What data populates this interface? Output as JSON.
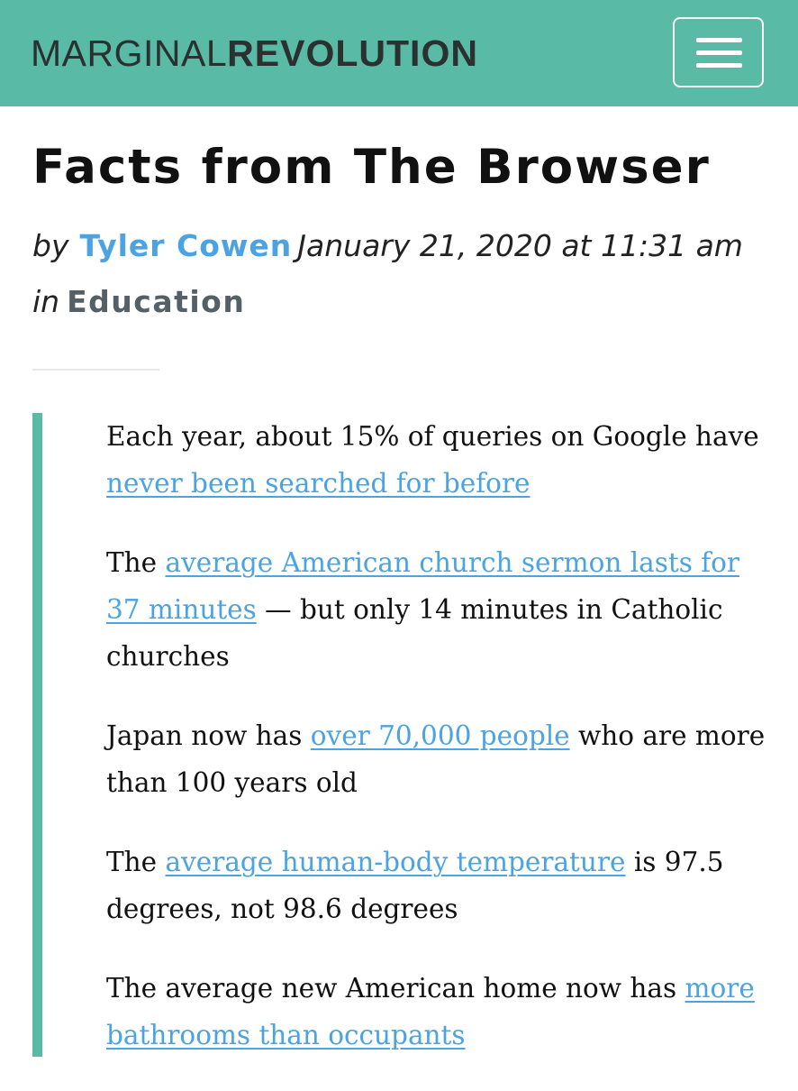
{
  "header": {
    "logo_light": "MARGINAL",
    "logo_bold": "REVOLUTION",
    "menu_icon": "hamburger-menu-icon",
    "background_color": "#59baa5"
  },
  "post": {
    "title": "Facts from The Browser",
    "byline_prefix": "by",
    "author": "Tyler Cowen",
    "date": "January 21, 2020 at 11:31 am",
    "category_prefix": "in",
    "category": "Education"
  },
  "quote": {
    "paragraphs": [
      {
        "before": "Each year, about 15% of queries on Google have ",
        "link": "never been searched for before",
        "after": ""
      },
      {
        "before": "The ",
        "link": "average American church sermon lasts for 37 minutes",
        "after": " — but only 14 minutes in Catholic churches"
      },
      {
        "before": "Japan now has ",
        "link": "over 70,000 people",
        "after": " who are more than 100 years old"
      },
      {
        "before": "The ",
        "link": "average human-body temperature",
        "after": " is 97.5 degrees, not 98.6 degrees"
      },
      {
        "before": "The average new American home now has ",
        "link": "more bathrooms than occupants",
        "after": ""
      }
    ]
  },
  "colors": {
    "accent": "#59baa5",
    "link": "#4ba3e2",
    "category": "#555f66"
  }
}
